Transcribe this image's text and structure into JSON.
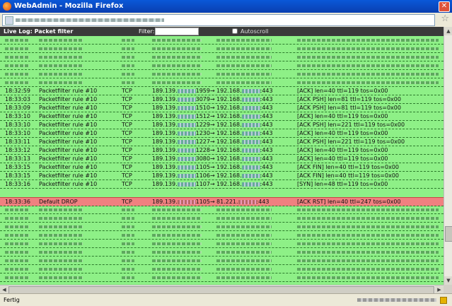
{
  "window": {
    "title": "WebAdmin - Mozilla Firefox"
  },
  "log": {
    "title": "Live Log: Packet filter",
    "filter_label": "Filter:",
    "filter_value": "",
    "autoscroll_label": "Autoscroll",
    "autoscroll_checked": false,
    "rows": [
      {
        "time": "18:32:59",
        "rule": "Packetfilter rule #10",
        "proto": "TCP",
        "src": "189.139.",
        "sport": "1959",
        "arrow": "→",
        "dst": "192.168.",
        "dport": ":443",
        "flags": "[ACK]  len=40  ttl=119  tos=0x00"
      },
      {
        "time": "18:33:03",
        "rule": "Packetfilter rule #10",
        "proto": "TCP",
        "src": "189.139.",
        "sport": "3079",
        "arrow": "→",
        "dst": "192.168.",
        "dport": ":443",
        "flags": "[ACK PSH]  len=81  ttl=119  tos=0x00"
      },
      {
        "time": "18:33:09",
        "rule": "Packetfilter rule #10",
        "proto": "TCP",
        "src": "189.139.",
        "sport": "1510",
        "arrow": "→",
        "dst": "192.168.",
        "dport": ":443",
        "flags": "[ACK PSH]  len=81  ttl=119  tos=0x00"
      },
      {
        "time": "18:33:10",
        "rule": "Packetfilter rule #10",
        "proto": "TCP",
        "src": "189.139.",
        "sport": "1512",
        "arrow": "→",
        "dst": "192.168.",
        "dport": ":443",
        "flags": "[ACK]  len=40  ttl=119  tos=0x00"
      },
      {
        "time": "18:33:10",
        "rule": "Packetfilter rule #10",
        "proto": "TCP",
        "src": "189.139.",
        "sport": "1229",
        "arrow": "→",
        "dst": "192.168.",
        "dport": ":443",
        "flags": "[ACK PSH]  len=221  ttl=119  tos=0x00"
      },
      {
        "time": "18:33:10",
        "rule": "Packetfilter rule #10",
        "proto": "TCP",
        "src": "189.139.",
        "sport": "1230",
        "arrow": "→",
        "dst": "192.168.",
        "dport": ":443",
        "flags": "[ACK]  len=40  ttl=119  tos=0x00"
      },
      {
        "time": "18:33:11",
        "rule": "Packetfilter rule #10",
        "proto": "TCP",
        "src": "189.139.",
        "sport": "1227",
        "arrow": "→",
        "dst": "192.168.",
        "dport": ":443",
        "flags": "[ACK PSH]  len=221  ttl=119  tos=0x00"
      },
      {
        "time": "18:33:12",
        "rule": "Packetfilter rule #10",
        "proto": "TCP",
        "src": "189.139.",
        "sport": "1228",
        "arrow": "→",
        "dst": "192.168.",
        "dport": ":443",
        "flags": "[ACK]  len=40  ttl=119  tos=0x00"
      },
      {
        "time": "18:33:13",
        "rule": "Packetfilter rule #10",
        "proto": "TCP",
        "src": "189.139.",
        "sport": "3080",
        "arrow": "→",
        "dst": "192.168.",
        "dport": ":443",
        "flags": "[ACK]  len=40  ttl=119  tos=0x00"
      },
      {
        "time": "18:33:15",
        "rule": "Packetfilter rule #10",
        "proto": "TCP",
        "src": "189.139.",
        "sport": "1105",
        "arrow": "→",
        "dst": "192.168.",
        "dport": ":443",
        "flags": "[ACK FIN]  len=40  ttl=119  tos=0x00"
      },
      {
        "time": "18:33:15",
        "rule": "Packetfilter rule #10",
        "proto": "TCP",
        "src": "189.139.",
        "sport": "1106",
        "arrow": "→",
        "dst": "192.168.",
        "dport": ":443",
        "flags": "[ACK FIN]  len=40  ttl=119  tos=0x00"
      },
      {
        "time": "18:33:16",
        "rule": "Packetfilter rule #10",
        "proto": "TCP",
        "src": "189.139.",
        "sport": "1107",
        "arrow": "→",
        "dst": "192.168.",
        "dport": ":443",
        "flags": "[SYN]  len=48  ttl=119  tos=0x00"
      }
    ],
    "drop_row": {
      "time": "18:33:36",
      "rule": "Default DROP",
      "proto": "TCP",
      "src": "189.139.",
      "sport": "1105",
      "arrow": "→",
      "dst": "81.221.",
      "dport": ":443",
      "flags": "[ACK RST]  len=40  ttl=247  tos=0x00"
    }
  },
  "status": {
    "text": "Fertig"
  },
  "colors": {
    "log_bg": "#8ef087",
    "drop_bg": "#f08080",
    "header_bg": "#3a3a3a"
  }
}
